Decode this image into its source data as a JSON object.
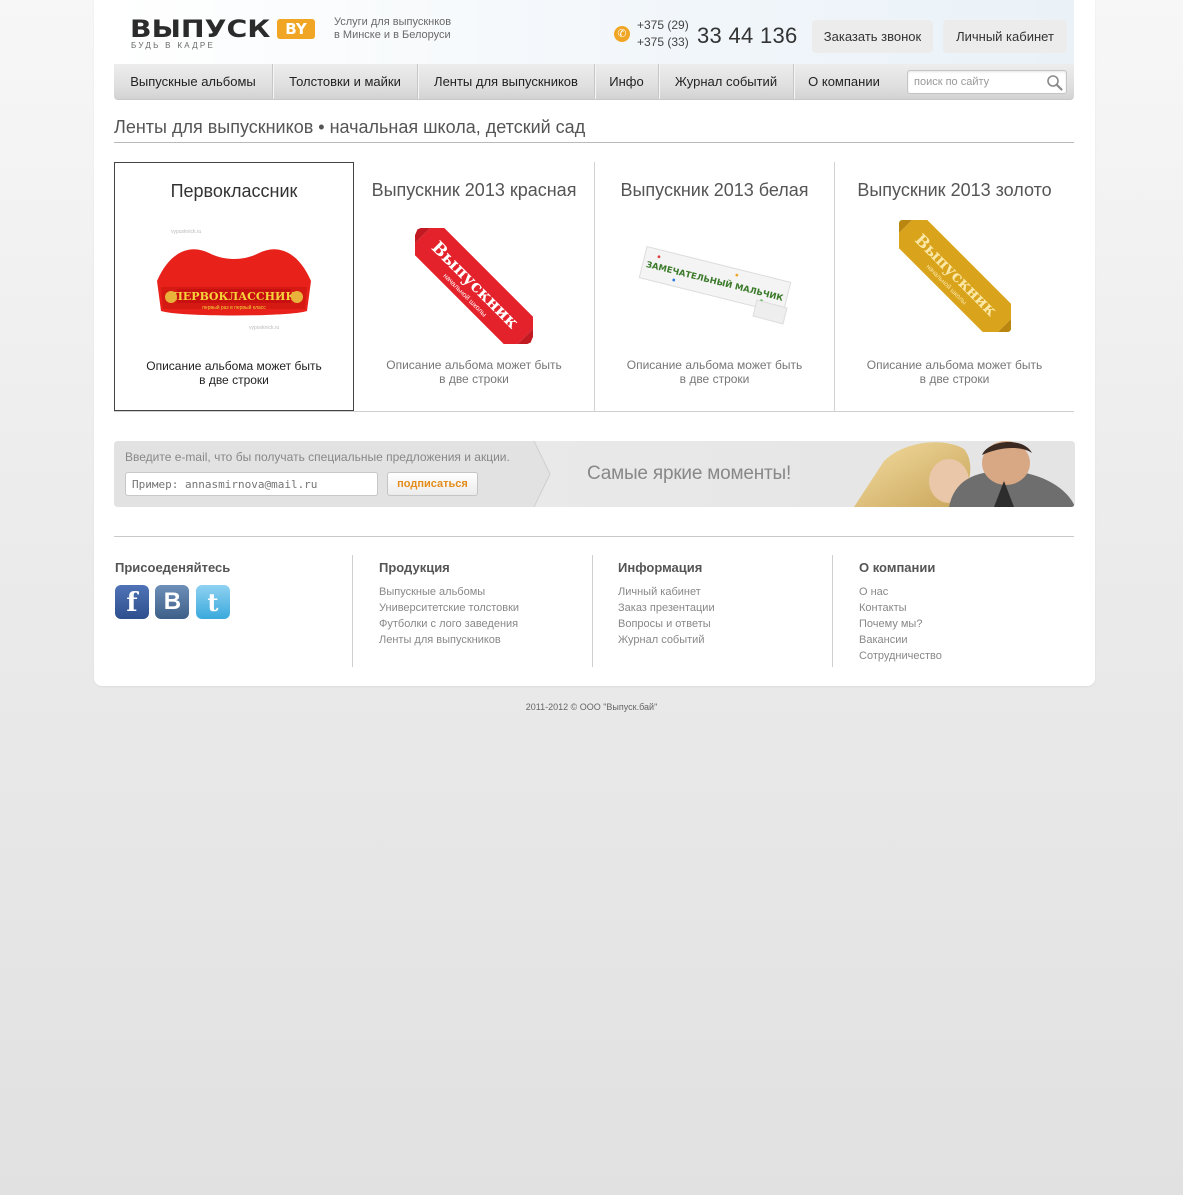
{
  "header": {
    "logo_text": "ВЫПУСК",
    "logo_badge": "BY",
    "logo_slogan": "будь в кадре",
    "services_line1": "Услуги для выпускнков",
    "services_line2": "в Минске и в Белоруси",
    "phone_code1": "+375 (29)",
    "phone_code2": "+375 (33)",
    "phone_number": "33 44 136",
    "call_button": "Заказать звонок",
    "cabinet_button": "Личный кабинет"
  },
  "nav": {
    "items": [
      {
        "label": "Выпускные альбомы"
      },
      {
        "label": "Толстовки и майки"
      },
      {
        "label": "Ленты для выпускников"
      },
      {
        "label": "Инфо"
      },
      {
        "label": "Журнал событий"
      },
      {
        "label": "О компании"
      }
    ],
    "search_placeholder": "поиск по сайту"
  },
  "page_title": "Ленты для выпускников • начальная школа, детский сад",
  "products": [
    {
      "title": "Первоклассник",
      "desc1": "Описание альбома может быть",
      "desc2": "в две строки",
      "ribbon_text": "ПЕРВОКЛАССНИК",
      "ribbon_sub": "первый раз в первый класс",
      "color": "#e8221a"
    },
    {
      "title": "Выпускник 2013 красная",
      "desc1": "Описание альбома может быть",
      "desc2": "в две строки",
      "ribbon_text": "Выпускник",
      "ribbon_sub": "начальной школы",
      "color": "#e3222b"
    },
    {
      "title": "Выпускник 2013 белая",
      "desc1": "Описание альбома может быть",
      "desc2": "в две строки",
      "ribbon_text": "ЗАМЕЧАТЕЛЬНЫЙ МАЛЬЧИК",
      "color": "#f4f4f4"
    },
    {
      "title": "Выпускник 2013 золото",
      "desc1": "Описание альбома может быть",
      "desc2": "в две строки",
      "ribbon_text": "Выпускник",
      "ribbon_sub": "начальной школы",
      "color": "#d9a31c"
    }
  ],
  "subscribe": {
    "caption": "Введите e-mail, что бы получать специальные предложения и акции.",
    "placeholder": "Пример: annasmirnova@mail.ru",
    "button": "подписаться",
    "slogan": "Самые яркие моменты!"
  },
  "footer": {
    "join": {
      "title": "Присоеденяйтесь",
      "networks": [
        "facebook-icon",
        "vkontakte-icon",
        "twitter-icon"
      ]
    },
    "products": {
      "title": "Продукция",
      "items": [
        "Выпускные альбомы",
        "Университетские толстовки",
        "Футболки с лого заведения",
        "Ленты для выпускников"
      ]
    },
    "info": {
      "title": "Информация",
      "items": [
        "Личный кабинет",
        "Заказ презентации",
        "Вопросы и ответы",
        "Журнал событий"
      ]
    },
    "company": {
      "title": "О компании",
      "items": [
        "О нас",
        "Контакты",
        "Почему мы?",
        "Вакансии",
        "Сотрудничество"
      ]
    }
  },
  "copyright": "2011-2012  ©  ООО \"Выпуск.бай\""
}
